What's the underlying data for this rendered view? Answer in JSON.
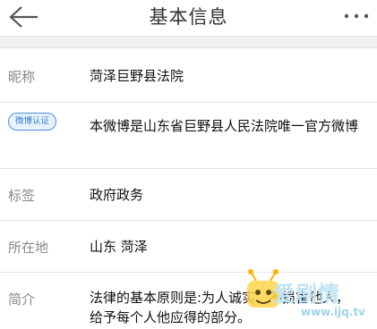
{
  "header": {
    "title": "基本信息",
    "back_icon": "back-arrow-icon",
    "more_icon": "more-dots-icon"
  },
  "profile": {
    "nickname_label": "昵称",
    "nickname_value": "菏泽巨野县法院",
    "verify_badge": "微博认证",
    "verify_value": "本微博是山东省巨野县人民法院唯一官方微博",
    "tags_label": "标签",
    "tags_value": "政府政务",
    "location_label": "所在地",
    "location_value": "山东 菏泽",
    "intro_label": "简介",
    "intro_value": "法律的基本原则是:为人诚实，不损害他人，给予每个人他应得的部分。"
  },
  "watermark": {
    "text": "爱剧情",
    "url": "www.ijq.tv"
  },
  "colors": {
    "badge_border": "#4a90d9",
    "badge_text": "#2f7dd0",
    "watermark": "#bfe3f5"
  }
}
